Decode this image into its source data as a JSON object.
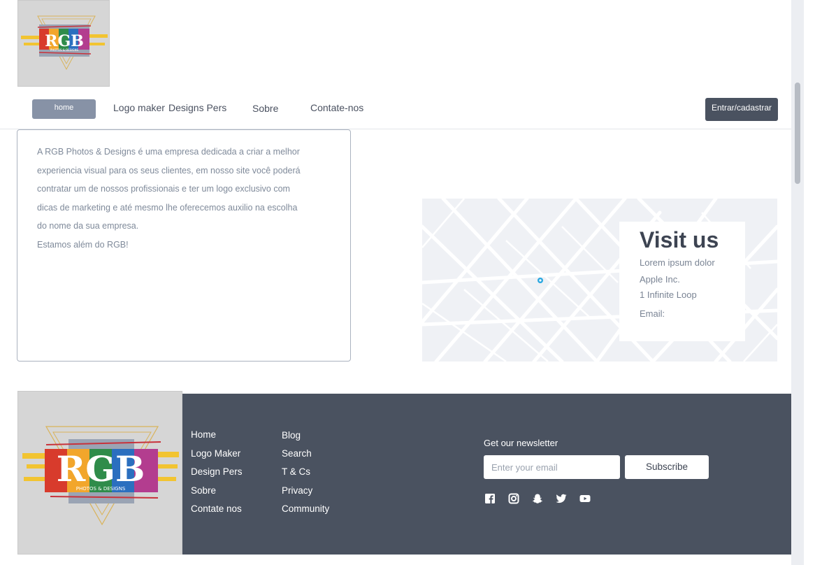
{
  "header": {
    "logo": {
      "name": "rgb-logo",
      "text": "RGB",
      "subtext": "PHOTOS & DESIGNS"
    }
  },
  "nav": {
    "home": "home",
    "links": [
      "Logo maker",
      "Designs Pers",
      "Sobre",
      "Contate-nos"
    ],
    "cta": "Entrar/cadastrar"
  },
  "about": {
    "lines": [
      "A RGB Photos & Designs é uma empresa dedicada a criar  a melhor",
      "experiencia visual para os seus clientes, em nosso site você poderá",
      "contratar um de nossos profissionais e ter um logo exclusivo com",
      "dicas de marketing e até mesmo lhe oferecemos auxilio na escolha",
      "do nome da sua empresa.",
      "Estamos além do RGB!"
    ]
  },
  "visit": {
    "title": "Visit us",
    "lines": [
      " Lorem ipsum dolor",
      "Apple Inc.",
      "1 Infinite Loop",
      "Email:"
    ]
  },
  "footer": {
    "col1": [
      "Home",
      "Logo Maker",
      "Design Pers",
      "Sobre",
      "Contate nos"
    ],
    "col2": [
      "Blog",
      "Search",
      "T & Cs",
      "Privacy",
      "Community"
    ],
    "newsletter_label": "Get our newsletter",
    "email_placeholder": "Enter your email",
    "subscribe": "Subscribe",
    "social_icons": [
      "facebook-icon",
      "instagram-icon",
      "snapchat-icon",
      "twitter-icon",
      "youtube-icon"
    ]
  },
  "colors": {
    "dark": "#4a5260",
    "accent": "#8792a6",
    "map_bg": "#eff1f5",
    "map_pin": "#2aa7e0"
  }
}
